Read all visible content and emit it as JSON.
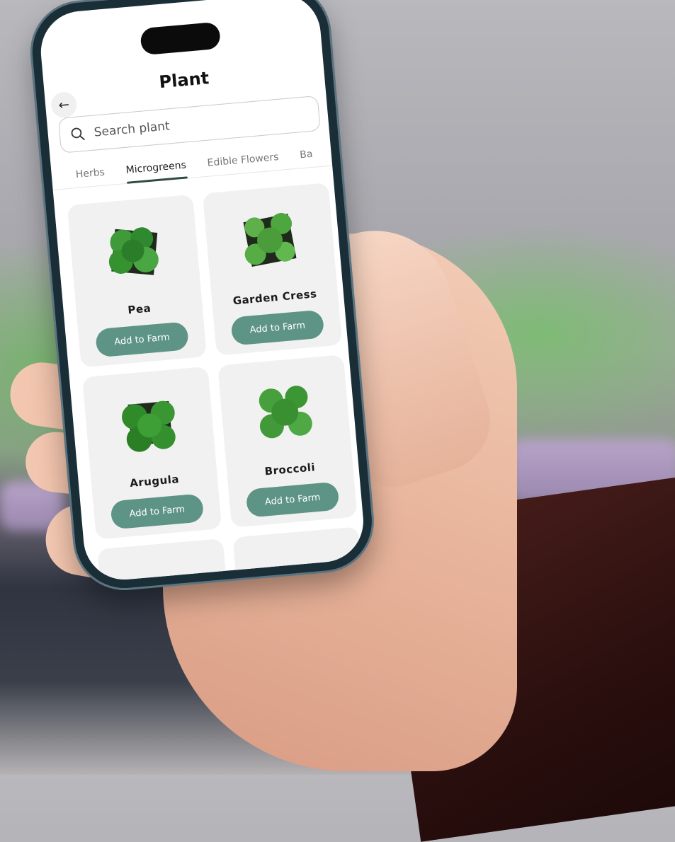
{
  "app": {
    "title": "Plant"
  },
  "search": {
    "placeholder": "Search plant"
  },
  "tabs": [
    {
      "label": "Herbs",
      "active": false
    },
    {
      "label": "Microgreens",
      "active": true
    },
    {
      "label": "Edible Flowers",
      "active": false
    },
    {
      "label": "Ba",
      "active": false
    }
  ],
  "plants": [
    {
      "name": "Pea",
      "button": "Add to Farm"
    },
    {
      "name": "Garden Cress",
      "button": "Add to Farm"
    },
    {
      "name": "Arugula",
      "button": "Add to Farm"
    },
    {
      "name": "Broccoli",
      "button": "Add to Farm"
    }
  ],
  "colors": {
    "accent": "#5e9486",
    "tab_indicator": "#2f4b46",
    "card_bg": "#f1f1f1"
  },
  "icons": {
    "back": "arrow-left-icon",
    "search": "search-icon"
  }
}
